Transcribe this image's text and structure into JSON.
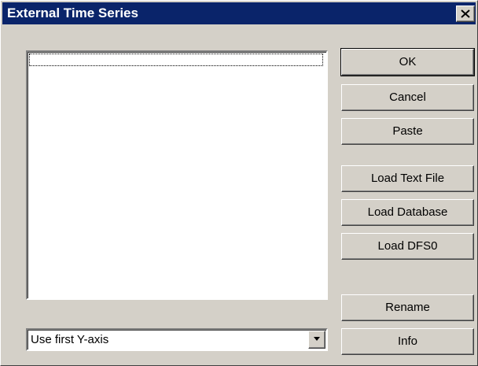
{
  "window": {
    "title": "External Time Series",
    "close_icon": "close-icon"
  },
  "list": {
    "items": []
  },
  "axis_select": {
    "selected": "Use first Y-axis",
    "arrow_icon": "chevron-down-icon"
  },
  "buttons": {
    "ok": "OK",
    "cancel": "Cancel",
    "paste": "Paste",
    "load_text_file": "Load Text File",
    "load_database": "Load Database",
    "load_dfs0": "Load DFS0",
    "rename": "Rename",
    "info": "Info"
  }
}
